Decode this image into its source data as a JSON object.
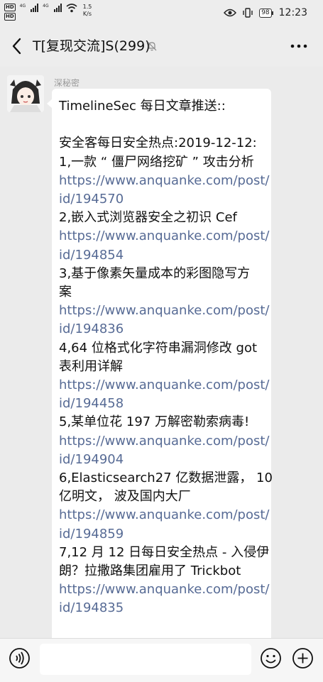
{
  "status_bar": {
    "hd1": "HD",
    "hd2": "HD",
    "net1": "4G",
    "net2": "4G",
    "speed_value": "1.5",
    "speed_unit": "K/s",
    "battery": "98",
    "time": "12:23"
  },
  "header": {
    "title": "T[复现交流]S(299)",
    "icons": [
      "back-arrow",
      "mute-bell",
      "more-dots"
    ]
  },
  "message": {
    "sender_name": "深秘密",
    "lines": [
      {
        "text": "TimelineSec 每日文章推送::",
        "link": false
      },
      {
        "text": "",
        "link": false
      },
      {
        "text": "安全客每日安全热点:2019-12-12:",
        "link": false
      },
      {
        "text": "1,一款 “ 僵尸网络挖矿 ” 攻击分析",
        "link": false
      },
      {
        "text": "https://www.anquanke.com/post/",
        "link": true
      },
      {
        "text": "id/194570",
        "link": true
      },
      {
        "text": "2,嵌入式浏览器安全之初识 Cef",
        "link": false
      },
      {
        "text": "https://www.anquanke.com/post/",
        "link": true
      },
      {
        "text": "id/194854",
        "link": true
      },
      {
        "text": "3,基于像素矢量成本的彩图隐写方",
        "link": false
      },
      {
        "text": "案",
        "link": false
      },
      {
        "text": "https://www.anquanke.com/post/",
        "link": true
      },
      {
        "text": "id/194836",
        "link": true
      },
      {
        "text": "4,64 位格式化字符串漏洞修改 got",
        "link": false
      },
      {
        "text": "表利用详解",
        "link": false
      },
      {
        "text": "https://www.anquanke.com/post/",
        "link": true
      },
      {
        "text": "id/194458",
        "link": true
      },
      {
        "text": "5,某单位花 197 万解密勒索病毒!",
        "link": false
      },
      {
        "text": "https://www.anquanke.com/post/",
        "link": true
      },
      {
        "text": "id/194904",
        "link": true
      },
      {
        "text": "6,Elasticsearch27 亿数据泄露， 10",
        "link": false
      },
      {
        "text": "亿明文， 波及国内大厂",
        "link": false
      },
      {
        "text": "https://www.anquanke.com/post/",
        "link": true
      },
      {
        "text": "id/194859",
        "link": true
      },
      {
        "text": "7,12 月 12 日每日安全热点 - 入侵伊",
        "link": false
      },
      {
        "text": "朗？拉撒路集团雇用了 Trickbot",
        "link": false
      },
      {
        "text": "https://www.anquanke.com/post/",
        "link": true
      },
      {
        "text": "id/194835",
        "link": true
      }
    ]
  },
  "input_bar": {
    "icons": [
      "voice-icon",
      "emoji-icon",
      "plus-icon"
    ],
    "placeholder": ""
  },
  "colors": {
    "background": "#ebebeb",
    "bubble": "#ffffff",
    "link": "#576b95",
    "bar": "#ededed"
  }
}
